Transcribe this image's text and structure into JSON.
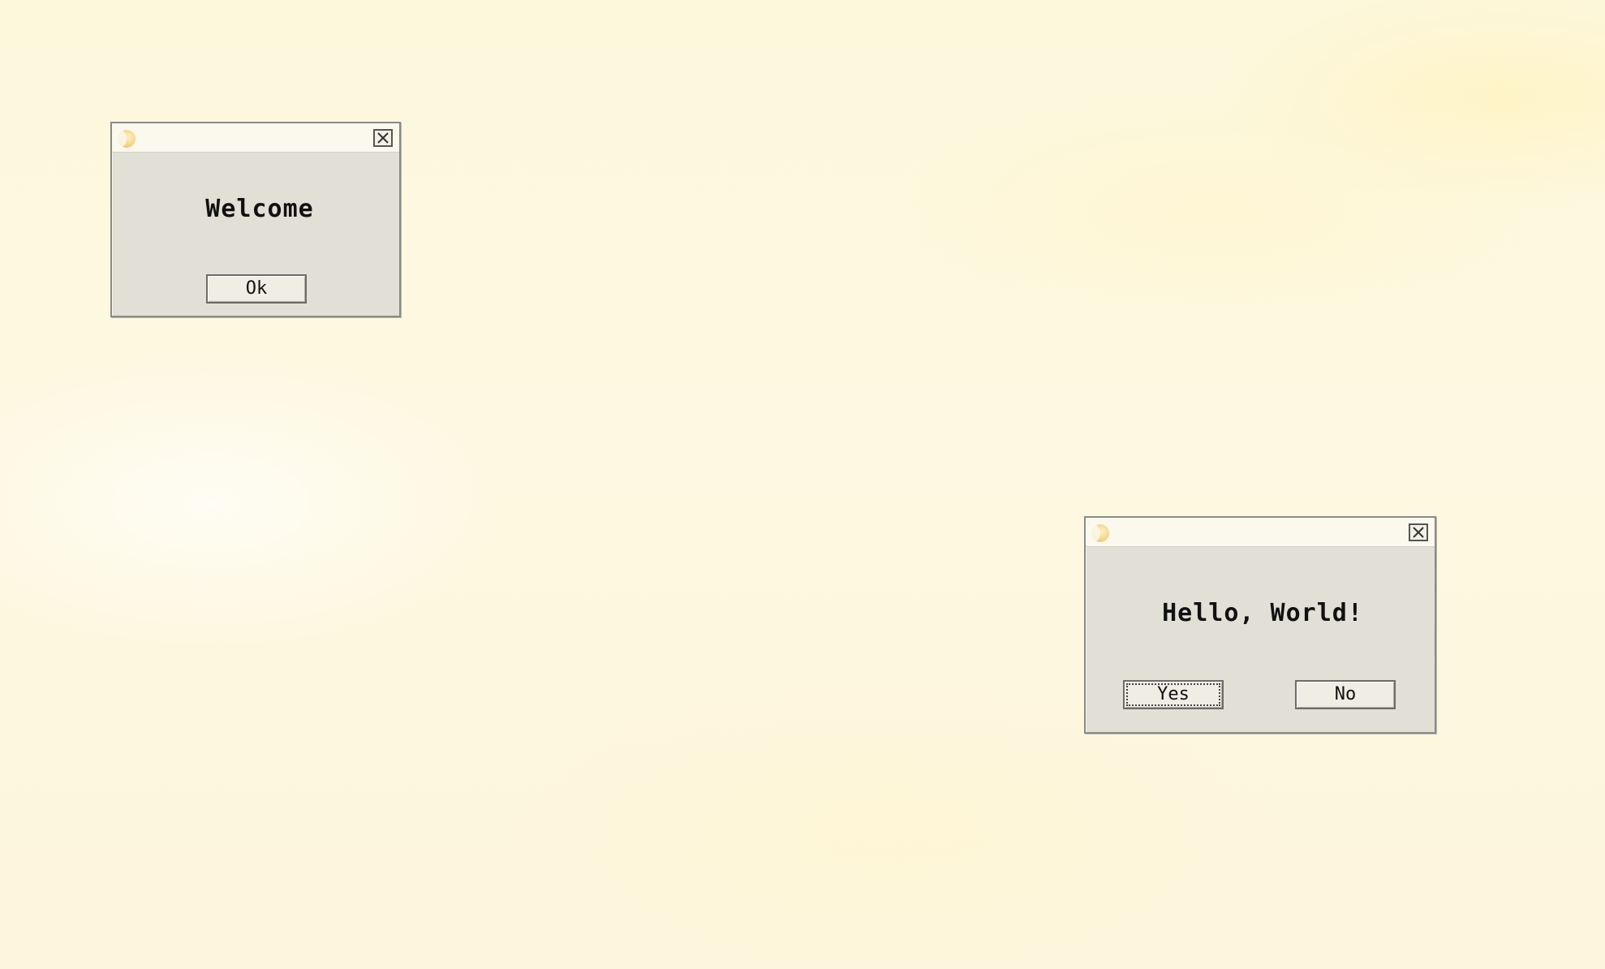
{
  "desktop": {
    "background_color": "#fdf7dc"
  },
  "welcome_dialog": {
    "message": "Welcome",
    "ok_label": "Ok",
    "close_icon": "close-icon"
  },
  "hello_dialog": {
    "message": "Hello, World!",
    "yes_label": "Yes",
    "no_label": "No",
    "close_icon": "close-icon",
    "focused_button": "Yes"
  },
  "colors": {
    "dialog_body": "#e2e0d6",
    "title_bar": "#fbf9ee",
    "border": "#8a8a86"
  }
}
